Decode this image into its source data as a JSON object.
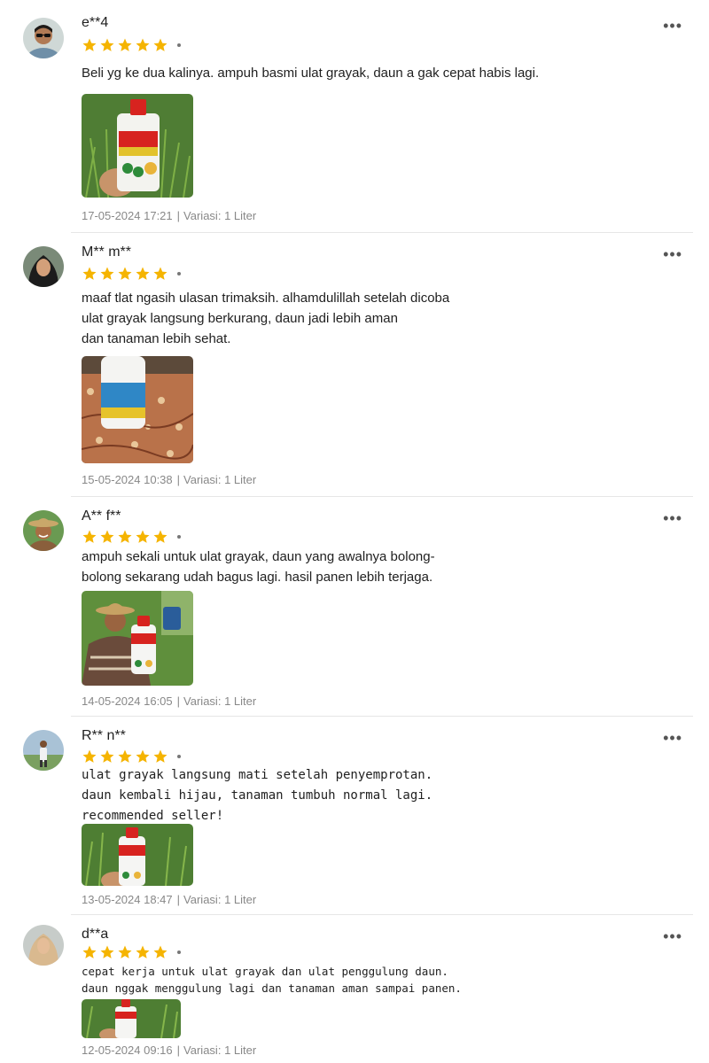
{
  "colors": {
    "star": "#F5B400",
    "meta_text": "#888888",
    "divider": "#E6E6E6"
  },
  "icons": {
    "rating": "star-icon",
    "more": "more-horizontal-icon"
  },
  "more_label": "•••",
  "variant_prefix": "Variasi:",
  "reviews": [
    {
      "username": "e**4",
      "rating": 5,
      "text": "Beli yg ke  dua kalinya. ampuh basmi ulat grayak, daun a gak cepat habis lagi.",
      "date": "17-05-2024 17:21",
      "variant": "1 Liter",
      "photo": "hand holding Monster bottle over green crop field"
    },
    {
      "username": "M**  m**",
      "rating": 5,
      "text": "maaf tlat ngasih ulasan trimaksih.   alhamdulillah setelah dicoba\nulat grayak langsung berkurang, daun jadi lebih aman\ndan tanaman lebih sehat.",
      "date": "15-05-2024 10:38",
      "variant": "1 Liter",
      "photo": "Monster bottle on batik cloth"
    },
    {
      "username": "A**  f**",
      "rating": 5,
      "text": "ampuh sekali untuk ulat grayak, daun yang awalnya bolong-\nbolong sekarang udah bagus lagi. hasil panen lebih terjaga.",
      "date": "14-05-2024 16:05",
      "variant": "1 Liter",
      "photo": "farmer with hat holding Monster bottle"
    },
    {
      "username": "R**  n**",
      "rating": 5,
      "text": "ulat grayak langsung mati setelah penyemprotan.\ndaun kembali hijau, tanaman tumbuh normal lagi.\nrecommended seller!",
      "date": "13-05-2024 18:47",
      "variant": "1 Liter",
      "photo": "hand holding Monster bottle over green field"
    },
    {
      "username": "d**a",
      "rating": 5,
      "text": "cepat kerja untuk ulat grayak dan ulat penggulung daun.\ndaun nggak menggulung lagi dan tanaman aman sampai panen.",
      "date": "12-05-2024 09:16",
      "variant": "1 Liter",
      "photo": "hand holding Monster bottle over crop field"
    }
  ]
}
